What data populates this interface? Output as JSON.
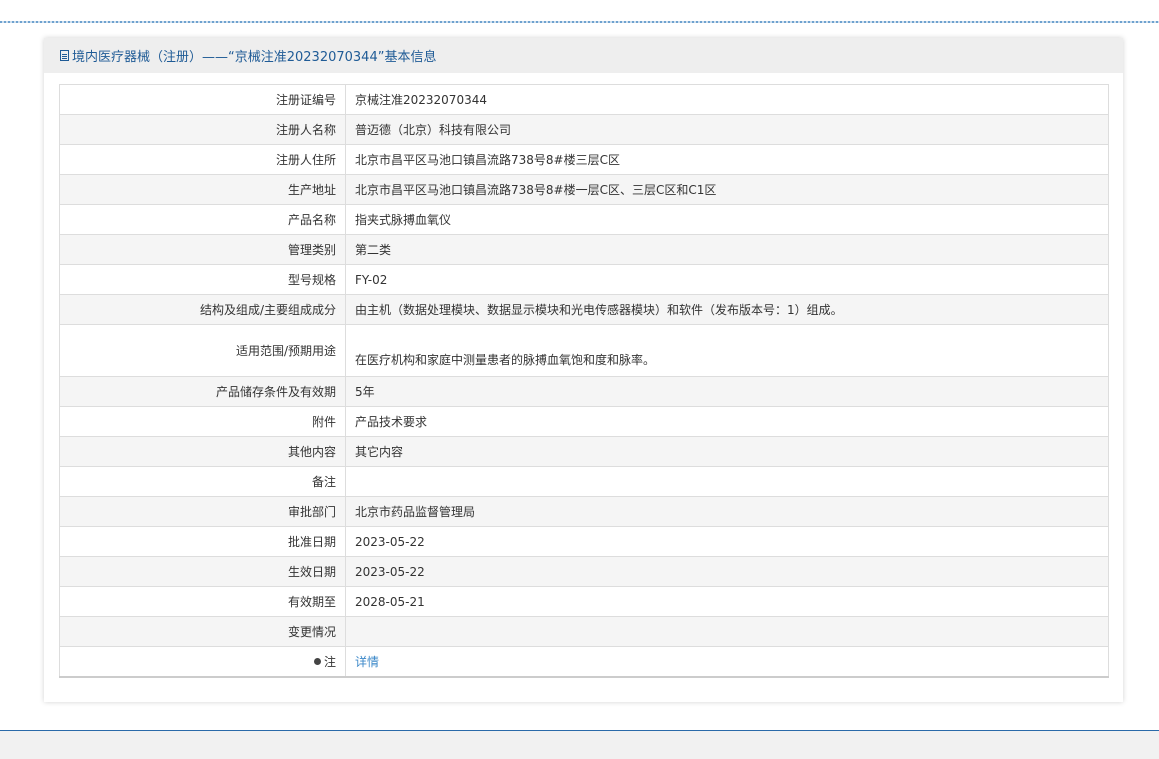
{
  "panel": {
    "title": "境内医疗器械（注册）——“京械注准20232070344”基本信息"
  },
  "rows": [
    {
      "label": "注册证编号",
      "value": "京械注准20232070344"
    },
    {
      "label": "注册人名称",
      "value": "普迈德（北京）科技有限公司"
    },
    {
      "label": "注册人住所",
      "value": "北京市昌平区马池口镇昌流路738号8#楼三层C区"
    },
    {
      "label": "生产地址",
      "value": "北京市昌平区马池口镇昌流路738号8#楼一层C区、三层C区和C1区"
    },
    {
      "label": "产品名称",
      "value": "指夹式脉搏血氧仪"
    },
    {
      "label": "管理类别",
      "value": "第二类"
    },
    {
      "label": "型号规格",
      "value": "FY-02"
    },
    {
      "label": "结构及组成/主要组成成分",
      "value": "由主机（数据处理模块、数据显示模块和光电传感器模块）和软件（发布版本号：1）组成。"
    },
    {
      "label": "适用范围/预期用途",
      "value": "在医疗机构和家庭中测量患者的脉搏血氧饱和度和脉率。"
    },
    {
      "label": "产品储存条件及有效期",
      "value": "5年"
    },
    {
      "label": "附件",
      "value": "产品技术要求"
    },
    {
      "label": "其他内容",
      "value": "其它内容"
    },
    {
      "label": "备注",
      "value": ""
    },
    {
      "label": "审批部门",
      "value": "北京市药品监督管理局"
    },
    {
      "label": "批准日期",
      "value": "2023-05-22"
    },
    {
      "label": "生效日期",
      "value": "2023-05-22"
    },
    {
      "label": "有效期至",
      "value": "2028-05-21"
    },
    {
      "label": "变更情况",
      "value": ""
    }
  ],
  "note": {
    "label": "注",
    "link": "详情",
    "icon": "pin-icon"
  },
  "colors": {
    "title": "#1f5b96",
    "link": "#3a87c8",
    "footer_rule": "#2a6aa9"
  }
}
